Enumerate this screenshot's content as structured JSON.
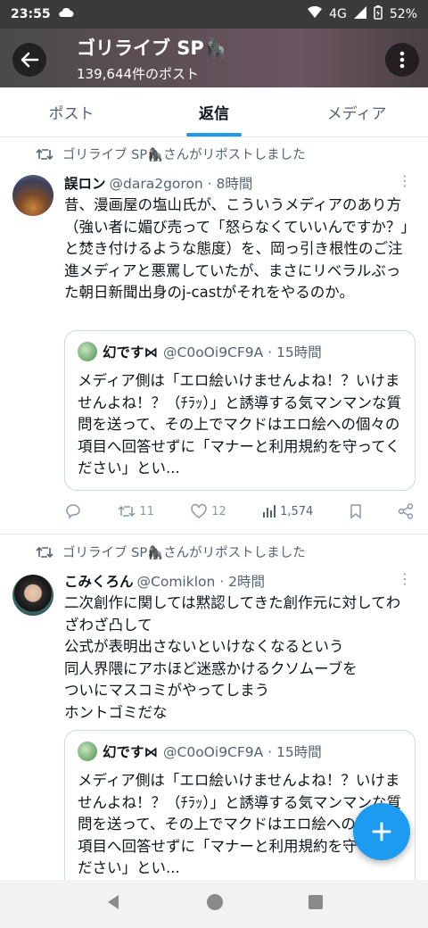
{
  "status": {
    "time": "23:55",
    "network": "4G",
    "battery": "52%"
  },
  "header": {
    "title": "ゴリライブ SP🦍",
    "subtitle": "139,644件のポスト"
  },
  "tabs": [
    "ポスト",
    "返信",
    "メディア"
  ],
  "active_tab": "返信",
  "posts": [
    {
      "repost_text": "ゴリライブ SP🦍さんがリポストしました",
      "name": "誤ロン",
      "handle": "@dara2goron · 8時間",
      "body": "昔、漫画屋の塩山氏が、こういうメディアのあり方（強い者に媚び売って「怒らなくていいんですか？」と焚き付けるような態度）を、岡っ引き根性のご注進メディアと悪罵していたが、まさにリベラルぶった朝日新聞出身のj-castがそれをやるのか。",
      "quote": {
        "name": "幻です⋈",
        "handle": "@C0oOi9CF9A · 15時間",
        "body": "メディア側は「エロ絵いけませんよね！？いけませんよね！？（ﾁﾗｯ）」と誘導する気マンマンな質問を送って、その上でマクドはエロ絵への個々の項目へ回答せずに「マナーと利用規約を守ってください」とい..."
      },
      "stats": {
        "replies": "",
        "reposts": "11",
        "likes": "12",
        "views": "1,574"
      }
    },
    {
      "repost_text": "ゴリライブ SP🦍さんがリポストしました",
      "name": "こみくろん",
      "handle": "@Comiklon · 2時間",
      "body": "二次創作に関しては黙認してきた創作元に対してわざわざ凸して\n公式が表明出さないといけなくなるという\n同人界隈にアホほど迷惑かけるクソムーブを\nついにマスコミがやってしまう\nホントゴミだな",
      "quote": {
        "name": "幻です⋈",
        "handle": "@C0oOi9CF9A · 15時間",
        "body": "メディア側は「エロ絵いけませんよね！？いけませんよね！？（ﾁﾗｯ）」と誘導する気マンマンな質問を送って、その上でマクドはエロ絵への個々の項目へ回答せずに「マナーと利用規約を守ってください」とい..."
      }
    }
  ]
}
